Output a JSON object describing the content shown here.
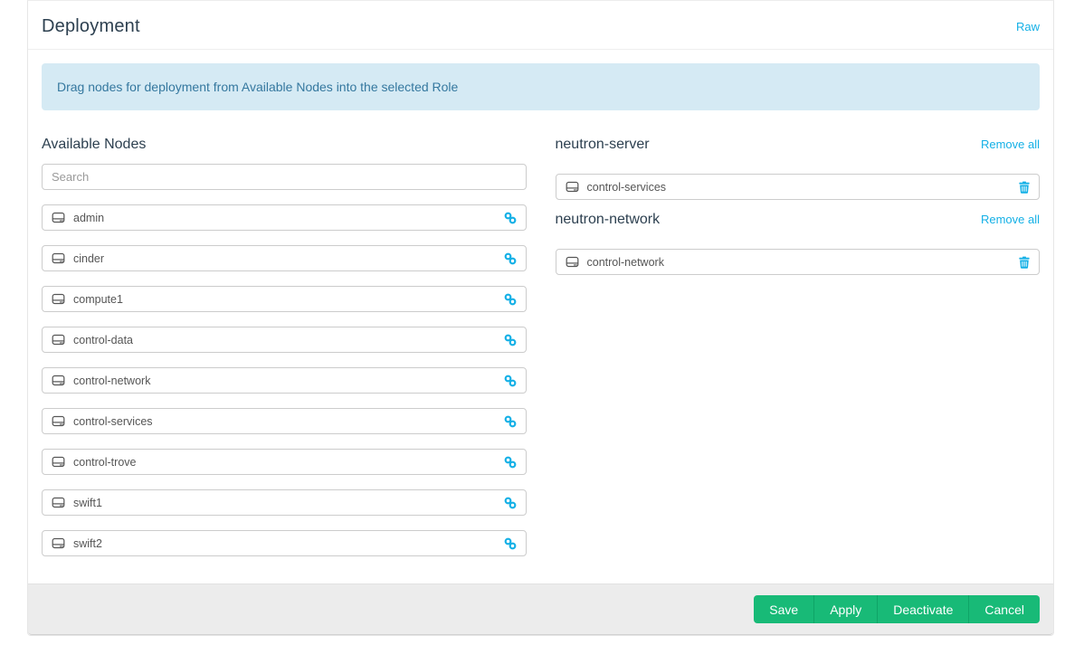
{
  "panel": {
    "title": "Deployment",
    "raw_link_label": "Raw",
    "banner_text": "Drag nodes for deployment from Available Nodes into the selected Role"
  },
  "available": {
    "heading": "Available Nodes",
    "search_placeholder": "Search",
    "search_value": "",
    "nodes": [
      "admin",
      "cinder",
      "compute1",
      "control-data",
      "control-network",
      "control-services",
      "control-trove",
      "swift1",
      "swift2"
    ]
  },
  "roles": [
    {
      "name": "neutron-server",
      "remove_all_label": "Remove all",
      "nodes": [
        "control-services"
      ]
    },
    {
      "name": "neutron-network",
      "remove_all_label": "Remove all",
      "nodes": [
        "control-network"
      ]
    }
  ],
  "footer": {
    "buttons": [
      "Save",
      "Apply",
      "Deactivate",
      "Cancel"
    ]
  },
  "colors": {
    "accent_cyan": "#14b0e6",
    "button_green": "#18ba77",
    "banner_background": "#d5eaf4",
    "banner_text": "#35789f",
    "heading_text": "#2d4050"
  },
  "icons": {
    "hdd": "hdd-icon",
    "link": "link-icon",
    "trash": "trash-icon"
  }
}
